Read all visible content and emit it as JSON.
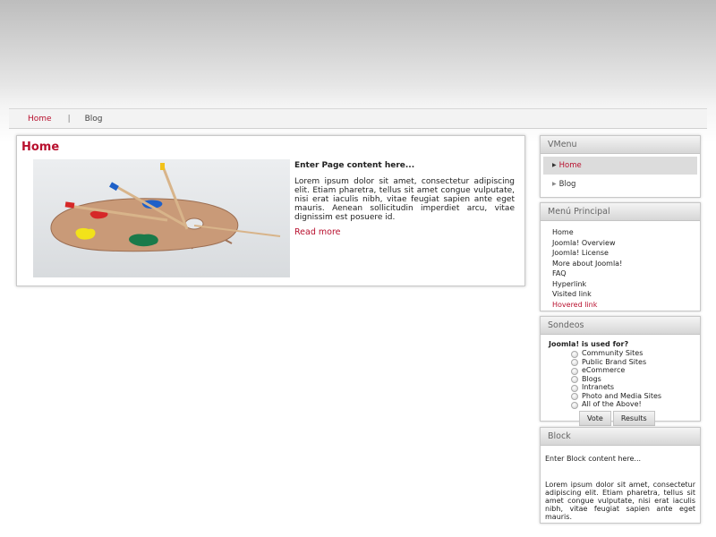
{
  "nav": {
    "items": [
      {
        "label": "Home",
        "active": true
      },
      {
        "label": "Blog",
        "active": false
      }
    ],
    "separator": "|"
  },
  "main": {
    "title": "Home",
    "image": "paint-palette-with-brushes",
    "article_heading": "Enter Page content here...",
    "article_body": "Lorem ipsum dolor sit amet, consectetur adipiscing elit. Etiam pharetra, tellus sit amet congue vulputate, nisi erat iaculis nibh, vitae feugiat sapien ante eget mauris. Aenean sollicitudin imperdiet arcu, vitae dignissim est posuere id.",
    "read_more": "Read more"
  },
  "sidebar": {
    "vmenu": {
      "title": "VMenu",
      "items": [
        {
          "label": "Home",
          "active": true
        },
        {
          "label": "Blog",
          "active": false
        }
      ]
    },
    "main_menu": {
      "title": "Menú Principal",
      "items": [
        "Home",
        "Joomla! Overview",
        "Joomla! License",
        "More about Joomla!",
        "FAQ",
        "Hyperlink",
        "Visited link",
        "Hovered link"
      ]
    },
    "poll": {
      "title": "Sondeos",
      "question": "Joomla! is used for?",
      "options": [
        "Community Sites",
        "Public Brand Sites",
        "eCommerce",
        "Blogs",
        "Intranets",
        "Photo and Media Sites",
        "All of the Above!"
      ],
      "vote_label": "Vote",
      "results_label": "Results"
    },
    "block": {
      "title": "Block",
      "heading": "Enter Block content here...",
      "body": "Lorem ipsum dolor sit amet, consectetur adipiscing elit. Etiam pharetra, tellus sit amet congue vulputate, nisi erat iaculis nibh, vitae feugiat sapien ante eget mauris."
    }
  },
  "colors": {
    "accent": "#b8102e",
    "panel_border": "#c9c9c9"
  }
}
